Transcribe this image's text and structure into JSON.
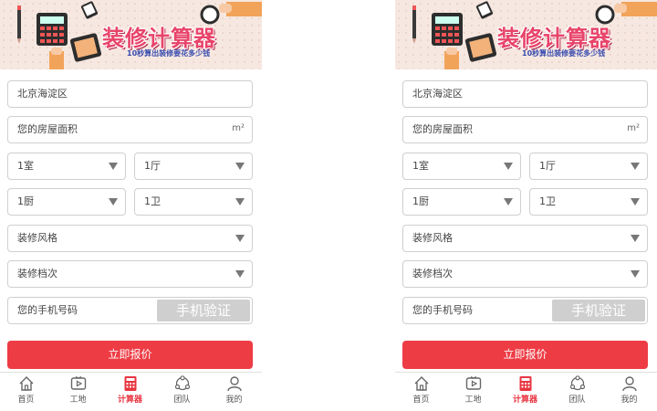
{
  "banner": {
    "title": "装修计算器",
    "subtitle": "10秒算出装修要花多少钱"
  },
  "form": {
    "location": "北京海淀区",
    "area_placeholder": "您的房屋面积",
    "area_unit": "m²",
    "room": "1室",
    "hall": "1厅",
    "kitchen": "1厨",
    "bath": "1卫",
    "style": "装修风格",
    "grade": "装修档次",
    "phone_placeholder": "您的手机号码",
    "verify_label": "手机验证"
  },
  "submit_label": "立即报价",
  "tabs": [
    {
      "label": "首页",
      "icon": "home-icon"
    },
    {
      "label": "工地",
      "icon": "tv-play-icon"
    },
    {
      "label": "计算器",
      "icon": "calculator-icon",
      "active": true
    },
    {
      "label": "团队",
      "icon": "team-icon"
    },
    {
      "label": "我的",
      "icon": "person-icon"
    }
  ],
  "colors": {
    "accent": "#ee3c45",
    "banner_bg": "#f6e8e1",
    "title": "#e8446a",
    "verify_bg": "#cfcfcf"
  }
}
